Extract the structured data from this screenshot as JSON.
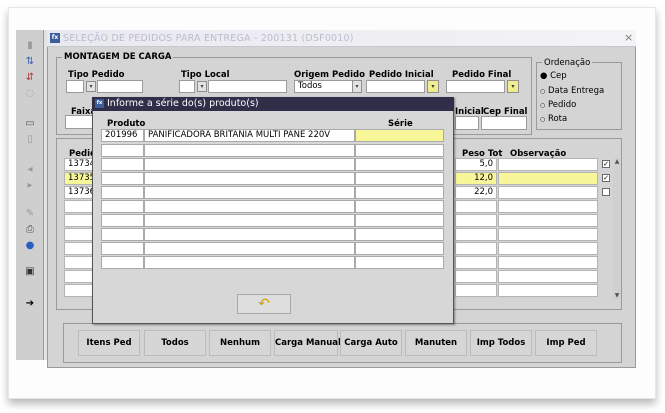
{
  "window": {
    "title": "SELEÇÃO DE PEDIDOS PARA ENTREGA - 200131 (DSF0010)",
    "app_icon": "forms-app-icon",
    "close": "×"
  },
  "left_toolbar": {
    "icons": [
      "exit-icon",
      "sort-icon",
      "sort-desc-icon",
      "refresh-icon",
      "new-record-icon",
      "copy-icon",
      "prev-icon",
      "next-icon",
      "edit-icon",
      "print-icon",
      "help-icon",
      "save-icon",
      "exit-arrow-icon"
    ]
  },
  "montagem": {
    "title": "MONTAGEM DE CARGA",
    "labels": {
      "tipo_pedido": "Tipo Pedido",
      "tipo_local": "Tipo Local",
      "origem_pedido": "Origem Pedido",
      "pedido_inicial": "Pedido Inicial",
      "pedido_final": "Pedido Final",
      "faixa": "Faixa",
      "cep_inicial": "Inicial",
      "cep_final": "Cep Final"
    },
    "origem_value": "Todos"
  },
  "ordenacao": {
    "title": "Ordenação",
    "options": [
      "Cep",
      "Data Entrega",
      "Pedido",
      "Rota"
    ],
    "selected": "Cep"
  },
  "table": {
    "headers": {
      "pedido": "Pedid",
      "peso_tot": "Peso Tot",
      "observacao": "Observação"
    },
    "rows": [
      {
        "pedido": "13734",
        "peso": "5,0",
        "checked": true,
        "selected": false
      },
      {
        "pedido": "13735",
        "peso": "12,0",
        "checked": true,
        "selected": true
      },
      {
        "pedido": "13736",
        "peso": "22,0",
        "checked": false,
        "selected": false
      }
    ]
  },
  "buttons": [
    "Itens Ped",
    "Todos",
    "Nenhum",
    "Carga Manual",
    "Carga Auto",
    "Manuten",
    "Imp Todos",
    "Imp Ped"
  ],
  "dialog": {
    "title": "Informe a série do(s) produto(s)",
    "headers": {
      "produto": "Produto",
      "serie": "Série"
    },
    "rows": [
      {
        "produto": "201996",
        "descricao": "PANIFICADORA BRITANIA MULTI PANE 220V",
        "serie": ""
      }
    ],
    "undo_icon": "undo-arrow-icon"
  },
  "colors": {
    "dialog_titlebar": "#302f49",
    "highlight_yellow": "#f7f79a",
    "window_bg": "#d4d4d4"
  }
}
